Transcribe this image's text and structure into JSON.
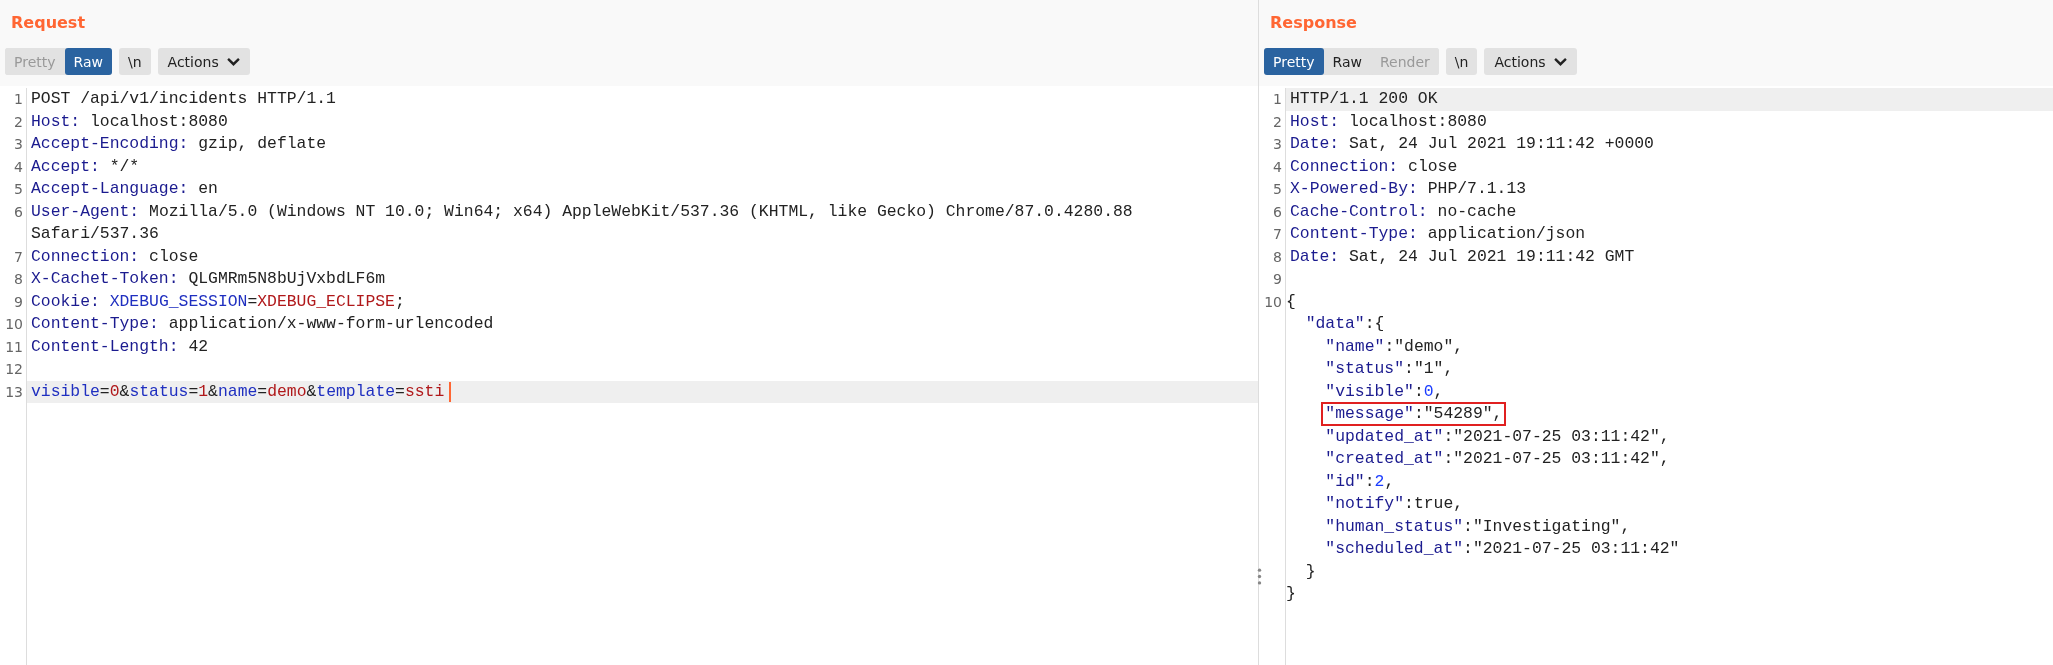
{
  "request": {
    "title": "Request",
    "tabs": [
      {
        "label": "Pretty",
        "selected": false,
        "disabled": true
      },
      {
        "label": "Raw",
        "selected": true,
        "disabled": false
      }
    ],
    "newline_button": "\\n",
    "actions_button": "Actions",
    "lines": [
      {
        "number": "1",
        "highlighted": false,
        "caret": false,
        "segments": [
          {
            "kind": "plain",
            "text": "POST /api/v1/incidents HTTP/1.1"
          }
        ]
      },
      {
        "number": "2",
        "highlighted": false,
        "caret": false,
        "segments": [
          {
            "kind": "name",
            "text": "Host:"
          },
          {
            "kind": "plain",
            "text": " localhost:8080"
          }
        ]
      },
      {
        "number": "3",
        "highlighted": false,
        "caret": false,
        "segments": [
          {
            "kind": "name",
            "text": "Accept-Encoding:"
          },
          {
            "kind": "plain",
            "text": " gzip, deflate"
          }
        ]
      },
      {
        "number": "4",
        "highlighted": false,
        "caret": false,
        "segments": [
          {
            "kind": "name",
            "text": "Accept:"
          },
          {
            "kind": "plain",
            "text": " */*"
          }
        ]
      },
      {
        "number": "5",
        "highlighted": false,
        "caret": false,
        "segments": [
          {
            "kind": "name",
            "text": "Accept-Language:"
          },
          {
            "kind": "plain",
            "text": " en"
          }
        ]
      },
      {
        "number": "6",
        "highlighted": false,
        "caret": false,
        "segments": [
          {
            "kind": "name",
            "text": "User-Agent:"
          },
          {
            "kind": "plain",
            "text": " Mozilla/5.0 (Windows NT 10.0; Win64; x64) AppleWebKit/537.36 (KHTML, like Gecko) Chrome/87.0.4280.88"
          }
        ]
      },
      {
        "highlighted": false,
        "caret": false,
        "segments": [
          {
            "kind": "plain",
            "text": "Safari/537.36"
          }
        ]
      },
      {
        "number": "7",
        "highlighted": false,
        "caret": false,
        "segments": [
          {
            "kind": "name",
            "text": "Connection:"
          },
          {
            "kind": "plain",
            "text": " close"
          }
        ]
      },
      {
        "number": "8",
        "highlighted": false,
        "caret": false,
        "segments": [
          {
            "kind": "name",
            "text": "X-Cachet-Token:"
          },
          {
            "kind": "plain",
            "text": " QLGMRm5N8bUjVxbdLF6m"
          }
        ]
      },
      {
        "number": "9",
        "highlighted": false,
        "caret": false,
        "segments": [
          {
            "kind": "name",
            "text": "Cookie:"
          },
          {
            "kind": "param",
            "text": " XDEBUG_SESSION"
          },
          {
            "kind": "plain",
            "text": "="
          },
          {
            "kind": "value",
            "text": "XDEBUG_ECLIPSE"
          },
          {
            "kind": "plain",
            "text": ";"
          }
        ]
      },
      {
        "number": "10",
        "highlighted": false,
        "caret": false,
        "segments": [
          {
            "kind": "name",
            "text": "Content-Type:"
          },
          {
            "kind": "plain",
            "text": " application/x-www-form-urlencoded"
          }
        ]
      },
      {
        "number": "11",
        "highlighted": false,
        "caret": false,
        "segments": [
          {
            "kind": "name",
            "text": "Content-Length:"
          },
          {
            "kind": "plain",
            "text": " 42"
          }
        ]
      },
      {
        "number": "12",
        "highlighted": false,
        "caret": false
      },
      {
        "number": "13",
        "highlighted": true,
        "caret": true,
        "segments": [
          {
            "kind": "param",
            "text": "visible"
          },
          {
            "kind": "plain",
            "text": "="
          },
          {
            "kind": "value",
            "text": "0"
          },
          {
            "kind": "plain",
            "text": "&"
          },
          {
            "kind": "param",
            "text": "status"
          },
          {
            "kind": "plain",
            "text": "="
          },
          {
            "kind": "value",
            "text": "1"
          },
          {
            "kind": "plain",
            "text": "&"
          },
          {
            "kind": "param",
            "text": "name"
          },
          {
            "kind": "plain",
            "text": "="
          },
          {
            "kind": "value",
            "text": "demo"
          },
          {
            "kind": "plain",
            "text": "&"
          },
          {
            "kind": "param",
            "text": "template"
          },
          {
            "kind": "plain",
            "text": "="
          },
          {
            "kind": "value",
            "text": "ssti"
          }
        ]
      }
    ]
  },
  "response": {
    "title": "Response",
    "tabs": [
      {
        "label": "Pretty",
        "selected": true,
        "disabled": false
      },
      {
        "label": "Raw",
        "selected": false,
        "disabled": false
      },
      {
        "label": "Render",
        "selected": false,
        "disabled": true
      }
    ],
    "newline_button": "\\n",
    "actions_button": "Actions",
    "lines": [
      {
        "number": "1",
        "highlighted": true,
        "caret": false,
        "segments": [
          {
            "kind": "plain",
            "text": "HTTP/1.1 200 OK"
          }
        ]
      },
      {
        "number": "2",
        "highlighted": false,
        "caret": false,
        "segments": [
          {
            "kind": "name",
            "text": "Host:"
          },
          {
            "kind": "plain",
            "text": " localhost:8080"
          }
        ]
      },
      {
        "number": "3",
        "highlighted": false,
        "caret": false,
        "segments": [
          {
            "kind": "name",
            "text": "Date:"
          },
          {
            "kind": "plain",
            "text": " Sat, 24 Jul 2021 19:11:42 +0000"
          }
        ]
      },
      {
        "number": "4",
        "highlighted": false,
        "caret": false,
        "segments": [
          {
            "kind": "name",
            "text": "Connection:"
          },
          {
            "kind": "plain",
            "text": " close"
          }
        ]
      },
      {
        "number": "5",
        "highlighted": false,
        "caret": false,
        "segments": [
          {
            "kind": "name",
            "text": "X-Powered-By:"
          },
          {
            "kind": "plain",
            "text": " PHP/7.1.13"
          }
        ]
      },
      {
        "number": "6",
        "highlighted": false,
        "caret": false,
        "segments": [
          {
            "kind": "name",
            "text": "Cache-Control:"
          },
          {
            "kind": "plain",
            "text": " no-cache"
          }
        ]
      },
      {
        "number": "7",
        "highlighted": false,
        "caret": false,
        "segments": [
          {
            "kind": "name",
            "text": "Content-Type:"
          },
          {
            "kind": "plain",
            "text": " application/json"
          }
        ]
      },
      {
        "number": "8",
        "highlighted": false,
        "caret": false,
        "segments": [
          {
            "kind": "name",
            "text": "Date:"
          },
          {
            "kind": "plain",
            "text": " Sat, 24 Jul 2021 19:11:42 GMT"
          }
        ]
      },
      {
        "number": "9",
        "highlighted": false,
        "caret": false
      }
    ],
    "json": [
      {
        "number": "10",
        "boxed": false,
        "segments": [
          {
            "kind": "plain",
            "text": "{"
          }
        ],
        "children": [
          {
            "boxed": false,
            "segments": [
              {
                "kind": "name",
                "text": "\"data\""
              },
              {
                "kind": "plain",
                "text": ":{"
              }
            ],
            "children": [
              {
                "boxed": false,
                "segments": [
                  {
                    "kind": "name",
                    "text": "\"name\""
                  },
                  {
                    "kind": "plain",
                    "text": ":\"demo\","
                  }
                ]
              },
              {
                "boxed": false,
                "segments": [
                  {
                    "kind": "name",
                    "text": "\"status\""
                  },
                  {
                    "kind": "plain",
                    "text": ":\"1\","
                  }
                ]
              },
              {
                "boxed": false,
                "segments": [
                  {
                    "kind": "name",
                    "text": "\"visible\""
                  },
                  {
                    "kind": "plain",
                    "text": ":"
                  },
                  {
                    "kind": "number",
                    "text": "0"
                  },
                  {
                    "kind": "plain",
                    "text": ","
                  }
                ]
              },
              {
                "boxed": true,
                "segments": [
                  {
                    "kind": "name",
                    "text": "\"message\""
                  },
                  {
                    "kind": "plain",
                    "text": ":\"54289\","
                  }
                ]
              },
              {
                "boxed": false,
                "segments": [
                  {
                    "kind": "name",
                    "text": "\"updated_at\""
                  },
                  {
                    "kind": "plain",
                    "text": ":\"2021-07-25 03:11:42\","
                  }
                ]
              },
              {
                "boxed": false,
                "segments": [
                  {
                    "kind": "name",
                    "text": "\"created_at\""
                  },
                  {
                    "kind": "plain",
                    "text": ":\"2021-07-25 03:11:42\","
                  }
                ]
              },
              {
                "boxed": false,
                "segments": [
                  {
                    "kind": "name",
                    "text": "\"id\""
                  },
                  {
                    "kind": "plain",
                    "text": ":"
                  },
                  {
                    "kind": "number",
                    "text": "2"
                  },
                  {
                    "kind": "plain",
                    "text": ","
                  }
                ]
              },
              {
                "boxed": false,
                "segments": [
                  {
                    "kind": "name",
                    "text": "\"notify\""
                  },
                  {
                    "kind": "plain",
                    "text": ":true,"
                  }
                ]
              },
              {
                "boxed": false,
                "segments": [
                  {
                    "kind": "name",
                    "text": "\"human_status\""
                  },
                  {
                    "kind": "plain",
                    "text": ":\"Investigating\","
                  }
                ]
              },
              {
                "boxed": false,
                "segments": [
                  {
                    "kind": "name",
                    "text": "\"scheduled_at\""
                  },
                  {
                    "kind": "plain",
                    "text": ":\"2021-07-25 03:11:42\""
                  }
                ]
              }
            ]
          },
          {
            "boxed": false,
            "segments": [
              {
                "kind": "plain",
                "text": "}"
              }
            ]
          }
        ]
      },
      {
        "boxed": false,
        "segments": [
          {
            "kind": "plain",
            "text": "}"
          }
        ]
      }
    ]
  }
}
